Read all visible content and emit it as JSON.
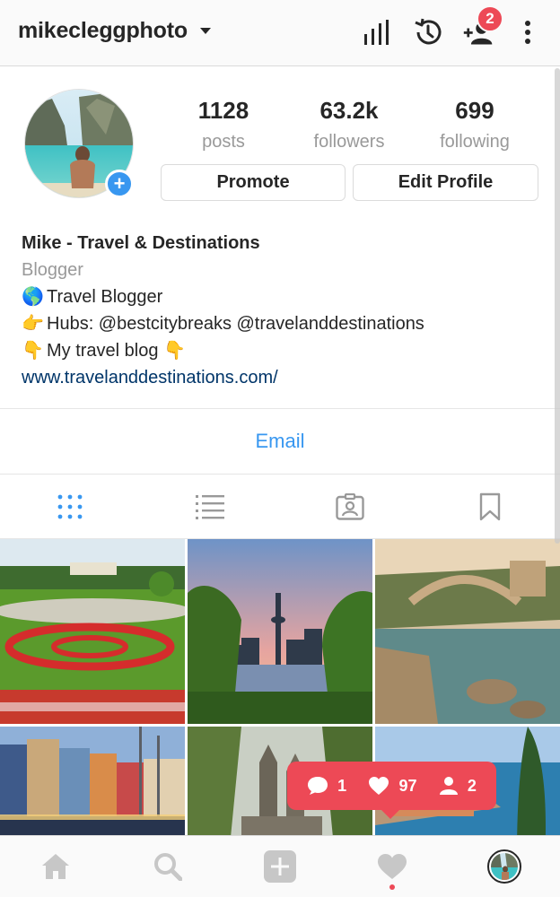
{
  "header": {
    "username": "mikecleggphoto",
    "notification_count": "2"
  },
  "stats": [
    {
      "value": "1128",
      "label": "posts"
    },
    {
      "value": "63.2k",
      "label": "followers"
    },
    {
      "value": "699",
      "label": "following"
    }
  ],
  "buttons": {
    "promote": "Promote",
    "edit_profile": "Edit Profile",
    "email": "Email"
  },
  "bio": {
    "name": "Mike - Travel & Destinations",
    "category": "Blogger",
    "line1": "Travel Blogger",
    "line2": "Hubs: @bestcitybreaks @travelanddestinations",
    "line3": "My travel blog",
    "link": "www.travelanddestinations.com/",
    "emoji_globe": "🌎",
    "emoji_point_right": "👉",
    "emoji_point_down": "👇"
  },
  "tabs": [
    "grid-icon",
    "list-icon",
    "tagged-icon",
    "saved-icon"
  ],
  "activity": {
    "comments": "1",
    "likes": "97",
    "follows": "2"
  },
  "colors": {
    "accent": "#3897f0",
    "badge": "#ed4956",
    "text": "#262626",
    "muted": "#999999",
    "link": "#003569"
  },
  "nav": [
    "home-icon",
    "search-icon",
    "add-post-icon",
    "activity-heart-icon",
    "profile-avatar"
  ]
}
